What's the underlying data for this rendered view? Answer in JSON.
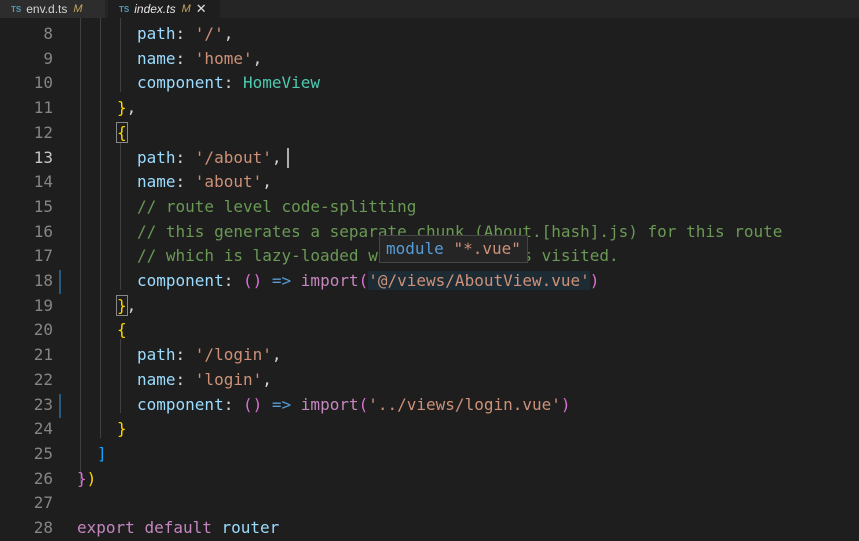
{
  "tabs": [
    {
      "icon": "TS",
      "name": "env.d.ts",
      "status": "M",
      "active": false
    },
    {
      "icon": "TS",
      "name": "index.ts",
      "status": "M",
      "active": true,
      "close": "✕"
    }
  ],
  "lines": [
    {
      "n": "8"
    },
    {
      "n": "9"
    },
    {
      "n": "10"
    },
    {
      "n": "11"
    },
    {
      "n": "12"
    },
    {
      "n": "13"
    },
    {
      "n": "14"
    },
    {
      "n": "15"
    },
    {
      "n": "16"
    },
    {
      "n": "17"
    },
    {
      "n": "18"
    },
    {
      "n": "19"
    },
    {
      "n": "20"
    },
    {
      "n": "21"
    },
    {
      "n": "22"
    },
    {
      "n": "23"
    },
    {
      "n": "24"
    },
    {
      "n": "25"
    },
    {
      "n": "26"
    },
    {
      "n": "27"
    },
    {
      "n": "28"
    }
  ],
  "code": {
    "l8_key": "path",
    "l8_val": "'/'",
    "l9_key": "name",
    "l9_val": "'home'",
    "l10_key": "component",
    "l10_val": "HomeView",
    "l13_key": "path",
    "l13_val": "'/about'",
    "l14_key": "name",
    "l14_val": "'about'",
    "l15_com": "// route level code-splitting",
    "l16_com": "// this generates a separate chunk (About.[hash].js) for this route",
    "l17_com": "// which is lazy-loaded when the route is visited.",
    "l18_key": "component",
    "l18_arrow": "() =>",
    "l18_import": "import",
    "l18_str": "'@/views/AboutView.vue'",
    "l21_key": "path",
    "l21_val": "'/login'",
    "l22_key": "name",
    "l22_val": "'login'",
    "l23_key": "component",
    "l23_arrow": "() =>",
    "l23_import": "import",
    "l23_str": "'../views/login.vue'",
    "l28_export": "export",
    "l28_default": "default",
    "l28_router": "router"
  },
  "hover": {
    "keyword": "module",
    "name": "\"*.vue\""
  }
}
